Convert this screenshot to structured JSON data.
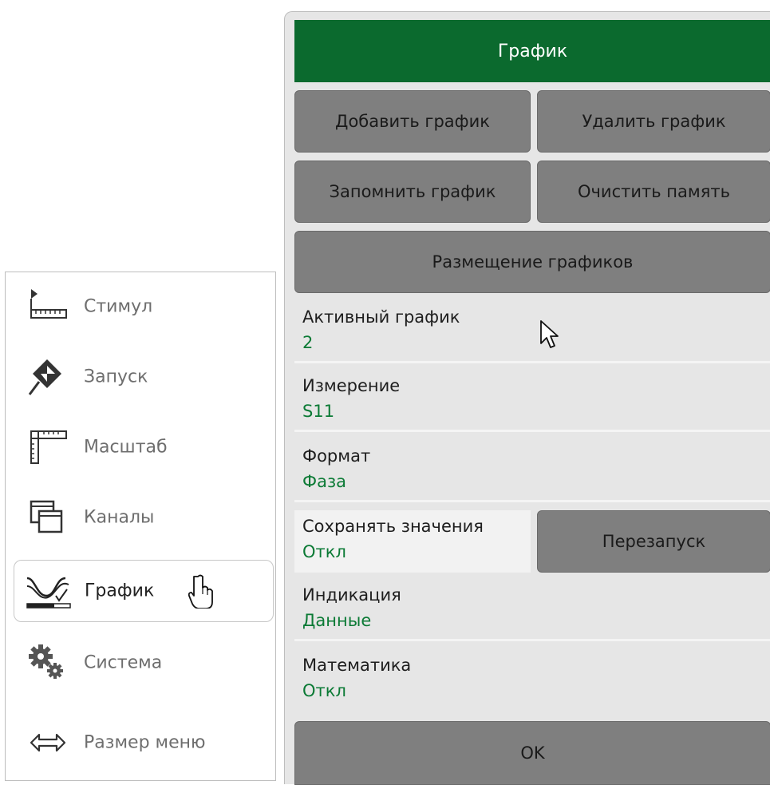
{
  "left_menu": {
    "items": [
      {
        "label": "Стимул",
        "icon": "stimulus-ruler-icon"
      },
      {
        "label": "Запуск",
        "icon": "trigger-diamond-icon"
      },
      {
        "label": "Масштаб",
        "icon": "scale-ruler-icon"
      },
      {
        "label": "Каналы",
        "icon": "channels-windows-icon"
      },
      {
        "label": "График",
        "icon": "trace-wave-icon",
        "selected": true
      },
      {
        "label": "Система",
        "icon": "system-gears-icon"
      },
      {
        "label": "Размер меню",
        "icon": "resize-arrows-icon"
      }
    ]
  },
  "panel": {
    "title": "График",
    "buttons": {
      "add_trace": "Добавить график",
      "delete_trace": "Удалить график",
      "memorize_trace": "Запомнить график",
      "clear_memory": "Очистить память",
      "trace_layout": "Размещение графиков",
      "restart": "Перезапуск",
      "ok": "OK"
    },
    "fields": {
      "active_trace": {
        "label": "Активный график",
        "value": "2"
      },
      "measurement": {
        "label": "Измерение",
        "value": "S11"
      },
      "format": {
        "label": "Формат",
        "value": "Фаза"
      },
      "hold": {
        "label": "Сохранять значения",
        "value": "Откл"
      },
      "display": {
        "label": "Индикация",
        "value": "Данные"
      },
      "math": {
        "label": "Математика",
        "value": "Откл"
      }
    }
  },
  "colors": {
    "title_bar": "#0b6a2e",
    "value_text": "#0b7a35",
    "button_bg": "#7f7f7f",
    "panel_bg": "#e6e6e6"
  }
}
